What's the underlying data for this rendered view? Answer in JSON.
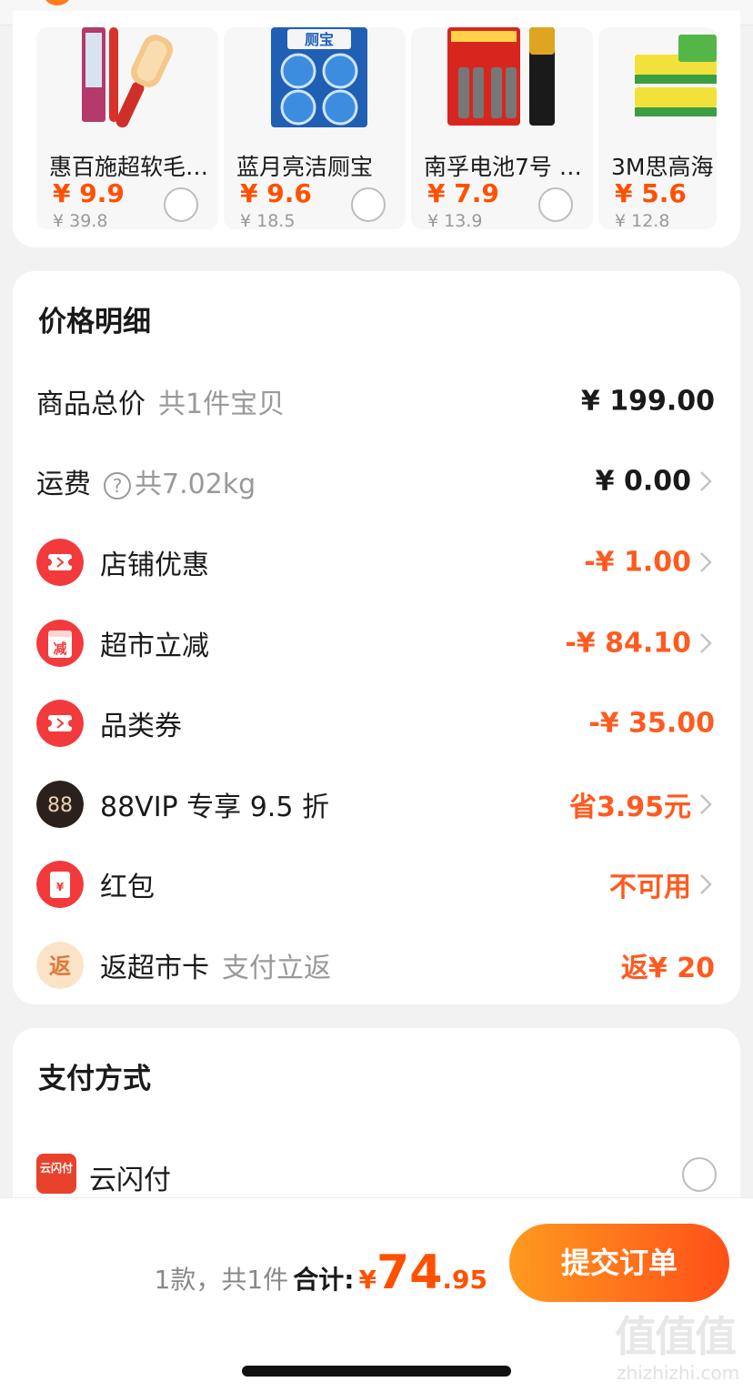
{
  "recommendations": [
    {
      "name": "惠百施超软毛…",
      "price": "¥ 9.9",
      "original_price": "¥ 39.8"
    },
    {
      "name": "蓝月亮洁厕宝",
      "price": "¥ 9.6",
      "original_price": "¥ 18.5"
    },
    {
      "name": "南孚电池7号 …",
      "price": "¥ 7.9",
      "original_price": "¥ 13.9"
    },
    {
      "name": "3M思高海",
      "price": "¥ 5.6",
      "original_price": "¥ 12.8"
    }
  ],
  "price_detail": {
    "title": "价格明细",
    "goods_total": {
      "label": "商品总价",
      "sub": "共1件宝贝",
      "value": "¥ 199.00"
    },
    "shipping": {
      "label": "运费",
      "help": "?",
      "sub": "共7.02kg",
      "value": "¥ 0.00"
    },
    "discounts": [
      {
        "icon": "coupon-icon",
        "label": "店铺优惠",
        "value": "-¥ 1.00",
        "color": "#ff5a1f"
      },
      {
        "icon": "reduce-icon",
        "icon_text": "减",
        "label": "超市立减",
        "value": "-¥ 84.10",
        "color": "#ff5a1f"
      },
      {
        "icon": "coupon-icon",
        "label": "品类券",
        "value": "-¥ 35.00",
        "color": "#ff5a1f"
      },
      {
        "icon": "vip-icon",
        "icon_text": "88",
        "label": "88VIP 专享 9.5 折",
        "value": "省3.95元",
        "color": "#ff5a1f"
      },
      {
        "icon": "red-packet-icon",
        "icon_text": "¥",
        "label": "红包",
        "value": "不可用",
        "color": "#ff5a1f"
      },
      {
        "icon": "cashback-icon",
        "icon_text": "返",
        "label": "返超市卡",
        "sub": "支付立返",
        "value": "返¥ 20",
        "color": "#ff5a1f"
      }
    ]
  },
  "payment": {
    "title": "支付方式",
    "method": {
      "logo_text": "云闪付",
      "label": "云闪付"
    }
  },
  "footer": {
    "count_text": "1款，共1件",
    "total_label": "合计:",
    "currency": "¥",
    "total_integer": "74",
    "total_decimal": ".95",
    "submit_label": "提交订单"
  },
  "watermark": {
    "glyphs": "值值值",
    "url": "zhizhizhi.com"
  },
  "colors": {
    "accent": "#ff5000",
    "discount": "#ff5a1f",
    "vip": "#2b211c"
  }
}
